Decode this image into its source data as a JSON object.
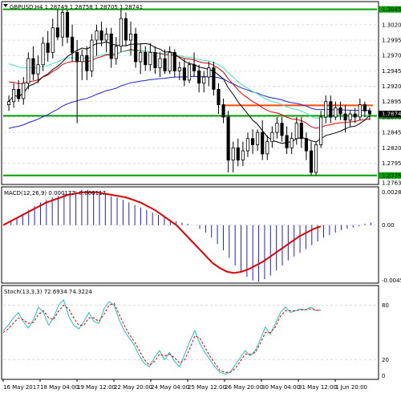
{
  "symbol_info": "GBPUSD,H4  1.28749 1.28758 1.28705 1.28741",
  "macd_label": "MACD(12,26,9) 0.000177 -0.000117",
  "stoch_label": "Stoch(13,3,3) 72.6934 74.3224",
  "price_axis_ticks": [
    "1.30450",
    "1.30200",
    "1.29950",
    "1.29700",
    "1.29450",
    "1.29200",
    "1.28950",
    "1.28700",
    "1.28450",
    "1.28200",
    "1.27950",
    "1.27750",
    "1.27630"
  ],
  "last_price_label": "1.28741",
  "macd_axis_ticks": [
    "0.002842",
    "0.00",
    "-0.004541"
  ],
  "stoch_axis_ticks": [
    "80",
    "20",
    "0"
  ],
  "time_axis_labels": [
    "16 May 2017",
    "18 May 04:00",
    "19 May 12:00",
    "22 May 20:00",
    "24 May 04:00",
    "25 May 12:00",
    "26 May 20:00",
    "30 May 04:00",
    "31 May 12:00",
    "1 Jun 20:00"
  ],
  "colors": {
    "bull_candle": "#ffffff",
    "bear_candle": "#000000",
    "grid": "#c8c8c8",
    "green_level": "#00a000",
    "orange_level": "#ff4a00",
    "ma_black": "#000000",
    "ma_blue": "#2020d0",
    "ma_red": "#e00000",
    "ma_cyan": "#40e0c0",
    "macd_hist": "#2020d0",
    "macd_signal": "#e00000",
    "stoch_main": "#20c0c0",
    "stoch_signal": "#e00000",
    "label_bg": "#00a000",
    "last_price_bg": "#000000"
  },
  "chart_data": [
    {
      "type": "line",
      "title": "GBPUSD,H4",
      "candles": [
        [
          1.289,
          1.2905,
          1.288,
          1.2895
        ],
        [
          1.2895,
          1.2925,
          1.2885,
          1.2915
        ],
        [
          1.2915,
          1.293,
          1.2895,
          1.29
        ],
        [
          1.29,
          1.2935,
          1.289,
          1.2925
        ],
        [
          1.2925,
          1.2975,
          1.2915,
          1.2965
        ],
        [
          1.2965,
          1.2985,
          1.293,
          1.294
        ],
        [
          1.294,
          1.297,
          1.2925,
          1.2955
        ],
        [
          1.2955,
          1.3,
          1.2945,
          1.299
        ],
        [
          1.299,
          1.301,
          1.296,
          1.2975
        ],
        [
          1.2975,
          1.303,
          1.2965,
          1.3015
        ],
        [
          1.3015,
          1.3045,
          1.2995,
          1.3
        ],
        [
          1.3,
          1.3045,
          1.2985,
          1.304
        ],
        [
          1.304,
          1.3045,
          1.299,
          1.3
        ],
        [
          1.3,
          1.302,
          1.296,
          1.2975
        ],
        [
          1.2975,
          1.2995,
          1.286,
          1.296
        ],
        [
          1.296,
          1.298,
          1.293,
          1.297
        ],
        [
          1.297,
          1.2985,
          1.293,
          1.2945
        ],
        [
          1.2945,
          1.3005,
          1.2935,
          1.2995
        ],
        [
          1.2995,
          1.302,
          1.297,
          1.301
        ],
        [
          1.301,
          1.3025,
          1.2985,
          1.2995
        ],
        [
          1.2995,
          1.3015,
          1.2975,
          1.3005
        ],
        [
          1.3005,
          1.3015,
          1.295,
          1.2965
        ],
        [
          1.2965,
          1.3,
          1.2955,
          1.2985
        ],
        [
          1.2985,
          1.3045,
          1.2975,
          1.303
        ],
        [
          1.303,
          1.304,
          1.2985,
          1.2995
        ],
        [
          1.2995,
          1.3025,
          1.297,
          1.3005
        ],
        [
          1.3005,
          1.3015,
          1.295,
          1.296
        ],
        [
          1.296,
          1.299,
          1.294,
          1.2975
        ],
        [
          1.2975,
          1.2985,
          1.2945,
          1.2955
        ],
        [
          1.2955,
          1.299,
          1.2945,
          1.2975
        ],
        [
          1.2975,
          1.2985,
          1.294,
          1.295
        ],
        [
          1.295,
          1.2975,
          1.2935,
          1.2965
        ],
        [
          1.2965,
          1.298,
          1.294,
          1.2945
        ],
        [
          1.2945,
          1.2985,
          1.294,
          1.2975
        ],
        [
          1.2975,
          1.298,
          1.2935,
          1.2945
        ],
        [
          1.2945,
          1.296,
          1.293,
          1.295
        ],
        [
          1.295,
          1.2965,
          1.292,
          1.293
        ],
        [
          1.293,
          1.296,
          1.2925,
          1.2955
        ],
        [
          1.2955,
          1.2975,
          1.2935,
          1.2945
        ],
        [
          1.2945,
          1.2955,
          1.291,
          1.2925
        ],
        [
          1.2925,
          1.2945,
          1.291,
          1.2935
        ],
        [
          1.2935,
          1.296,
          1.292,
          1.295
        ],
        [
          1.295,
          1.296,
          1.2905,
          1.2915
        ],
        [
          1.2915,
          1.2925,
          1.2875,
          1.289
        ],
        [
          1.289,
          1.29,
          1.286,
          1.287
        ],
        [
          1.287,
          1.288,
          1.278,
          1.28
        ],
        [
          1.28,
          1.283,
          1.278,
          1.282
        ],
        [
          1.282,
          1.2835,
          1.279,
          1.28
        ],
        [
          1.28,
          1.283,
          1.279,
          1.2815
        ],
        [
          1.2815,
          1.2845,
          1.2805,
          1.2835
        ],
        [
          1.2835,
          1.285,
          1.281,
          1.2825
        ],
        [
          1.2825,
          1.285,
          1.2815,
          1.2845
        ],
        [
          1.2845,
          1.2865,
          1.28,
          1.281
        ],
        [
          1.281,
          1.284,
          1.28,
          1.283
        ],
        [
          1.283,
          1.2855,
          1.282,
          1.2845
        ],
        [
          1.2845,
          1.287,
          1.2835,
          1.286
        ],
        [
          1.286,
          1.287,
          1.283,
          1.284
        ],
        [
          1.284,
          1.2855,
          1.281,
          1.282
        ],
        [
          1.282,
          1.2845,
          1.281,
          1.2835
        ],
        [
          1.2835,
          1.287,
          1.2825,
          1.286
        ],
        [
          1.286,
          1.287,
          1.282,
          1.2835
        ],
        [
          1.2835,
          1.2845,
          1.28,
          1.2815
        ],
        [
          1.2815,
          1.283,
          1.2775,
          1.278
        ],
        [
          1.278,
          1.283,
          1.2775,
          1.2825
        ],
        [
          1.2825,
          1.288,
          1.282,
          1.287
        ],
        [
          1.287,
          1.2905,
          1.286,
          1.2895
        ],
        [
          1.2895,
          1.2905,
          1.286,
          1.287
        ],
        [
          1.287,
          1.2895,
          1.2865,
          1.2885
        ],
        [
          1.2885,
          1.2895,
          1.2865,
          1.2875
        ],
        [
          1.2875,
          1.289,
          1.2845,
          1.2865
        ],
        [
          1.2865,
          1.288,
          1.2855,
          1.2875
        ],
        [
          1.2875,
          1.2885,
          1.286,
          1.287
        ],
        [
          1.287,
          1.29,
          1.2865,
          1.289
        ],
        [
          1.289,
          1.2895,
          1.287,
          1.288
        ],
        [
          1.288,
          1.2885,
          1.2865,
          1.2875
        ]
      ],
      "levels": {
        "green": [
          1.3045,
          1.2872,
          1.2775
        ],
        "orange": 1.2889
      },
      "ylim": [
        1.2763,
        1.3055
      ]
    },
    {
      "type": "bar",
      "title": "MACD(12,26,9)",
      "histogram": [
        0.0003,
        0.0006,
        0.0009,
        0.0012,
        0.0015,
        0.0018,
        0.002,
        0.0022,
        0.0023,
        0.0025,
        0.0026,
        0.0027,
        0.0028,
        0.0028,
        0.0027,
        0.0026,
        0.0025,
        0.0023,
        0.0022,
        0.002,
        0.0018,
        0.0016,
        0.0014,
        0.0012,
        0.001,
        0.0008,
        0.0006,
        0.0004,
        0.0003,
        0.0002,
        0.0001,
        0.0,
        -0.0003,
        -0.0006,
        -0.001,
        -0.0015,
        -0.002,
        -0.0026,
        -0.0032,
        -0.0037,
        -0.0041,
        -0.0044,
        -0.0045,
        -0.0043,
        -0.004,
        -0.0036,
        -0.0032,
        -0.0028,
        -0.0025,
        -0.0022,
        -0.0019,
        -0.0016,
        -0.0013,
        -0.001,
        -0.0008,
        -0.0006,
        -0.0004,
        -0.0003,
        -0.0002,
        -0.0001,
        0.0001,
        0.0002
      ],
      "signal": [
        0.0,
        0.0003,
        0.0006,
        0.0009,
        0.0012,
        0.0015,
        0.0018,
        0.002,
        0.0022,
        0.0024,
        0.0025,
        0.0026,
        0.0026,
        0.0026,
        0.0025,
        0.0024,
        0.0023,
        0.0022,
        0.002,
        0.0018,
        0.0015,
        0.0012,
        0.0008,
        0.0004,
        0.0,
        -0.0006,
        -0.0012,
        -0.0018,
        -0.0024,
        -0.003,
        -0.0034,
        -0.0037,
        -0.0038,
        -0.0037,
        -0.0035,
        -0.0032,
        -0.0029,
        -0.0025,
        -0.0021,
        -0.0017,
        -0.0013,
        -0.0009,
        -0.0006,
        -0.0003,
        -0.0001
      ],
      "ylim": [
        -0.004541,
        0.002842
      ]
    },
    {
      "type": "line",
      "title": "Stoch(13,3,3)",
      "series": [
        {
          "name": "main",
          "values": [
            52,
            58,
            66,
            72,
            62,
            55,
            64,
            78,
            72,
            58,
            66,
            80,
            86,
            68,
            58,
            54,
            62,
            72,
            62,
            60,
            76,
            84,
            80,
            64,
            52,
            44,
            36,
            24,
            16,
            12,
            22,
            30,
            20,
            28,
            18,
            12,
            26,
            40,
            52,
            38,
            28,
            20,
            12,
            6,
            4,
            6,
            14,
            22,
            30,
            24,
            30,
            42,
            56,
            48,
            60,
            72,
            78,
            72,
            74,
            76,
            75,
            78,
            74,
            75
          ]
        },
        {
          "name": "signal",
          "values": [
            50,
            54,
            60,
            66,
            64,
            60,
            61,
            70,
            74,
            66,
            64,
            74,
            80,
            76,
            66,
            58,
            58,
            66,
            66,
            62,
            70,
            80,
            82,
            70,
            58,
            48,
            40,
            30,
            20,
            14,
            18,
            26,
            24,
            26,
            22,
            16,
            20,
            32,
            46,
            44,
            34,
            24,
            16,
            8,
            6,
            6,
            10,
            18,
            26,
            26,
            28,
            38,
            50,
            50,
            56,
            68,
            74,
            74,
            74,
            75,
            75,
            76,
            75,
            74
          ]
        }
      ],
      "ylim": [
        0,
        100
      ]
    }
  ]
}
